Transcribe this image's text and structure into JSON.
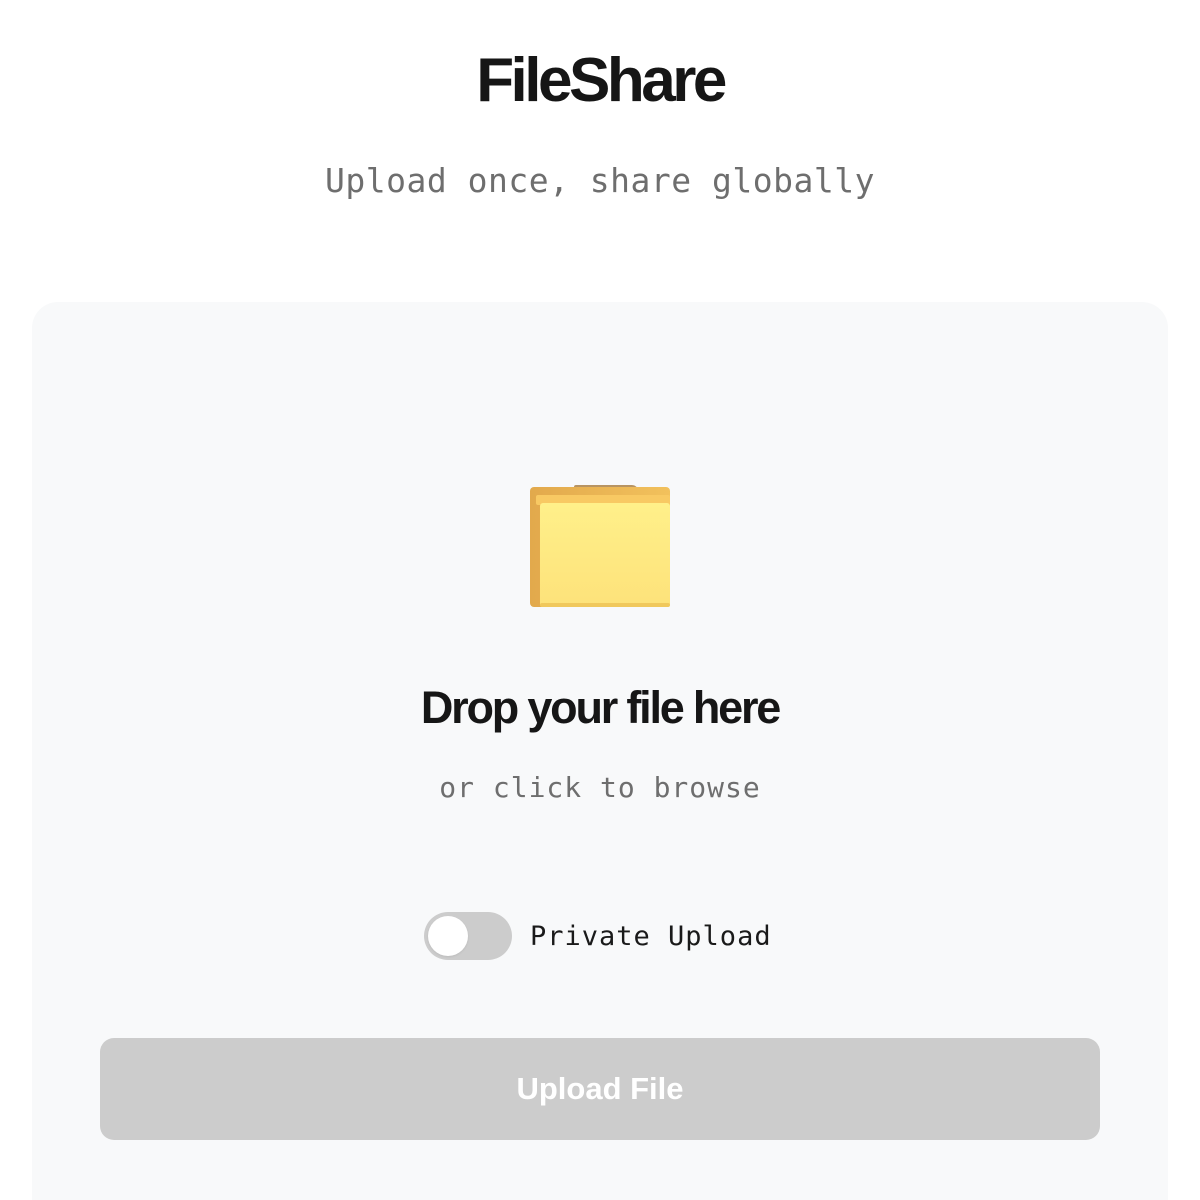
{
  "header": {
    "title": "FileShare",
    "tagline": "Upload once, share globally"
  },
  "dropzone": {
    "icon": "folder-icon",
    "title": "Drop your file here",
    "subtitle": "or click to browse"
  },
  "private_toggle": {
    "label": "Private Upload",
    "enabled": false
  },
  "upload_button": {
    "label": "Upload File",
    "disabled": true
  },
  "colors": {
    "background": "#ffffff",
    "dropzone_background": "#f8f9fa",
    "title_text": "#161616",
    "muted_text": "#6e6e6e",
    "toggle_off": "#cccccc",
    "button_disabled": "#cccccc",
    "button_text": "#ffffff",
    "folder_body": "#fde67a",
    "folder_back": "#e8b456",
    "folder_tab": "#b89462"
  }
}
